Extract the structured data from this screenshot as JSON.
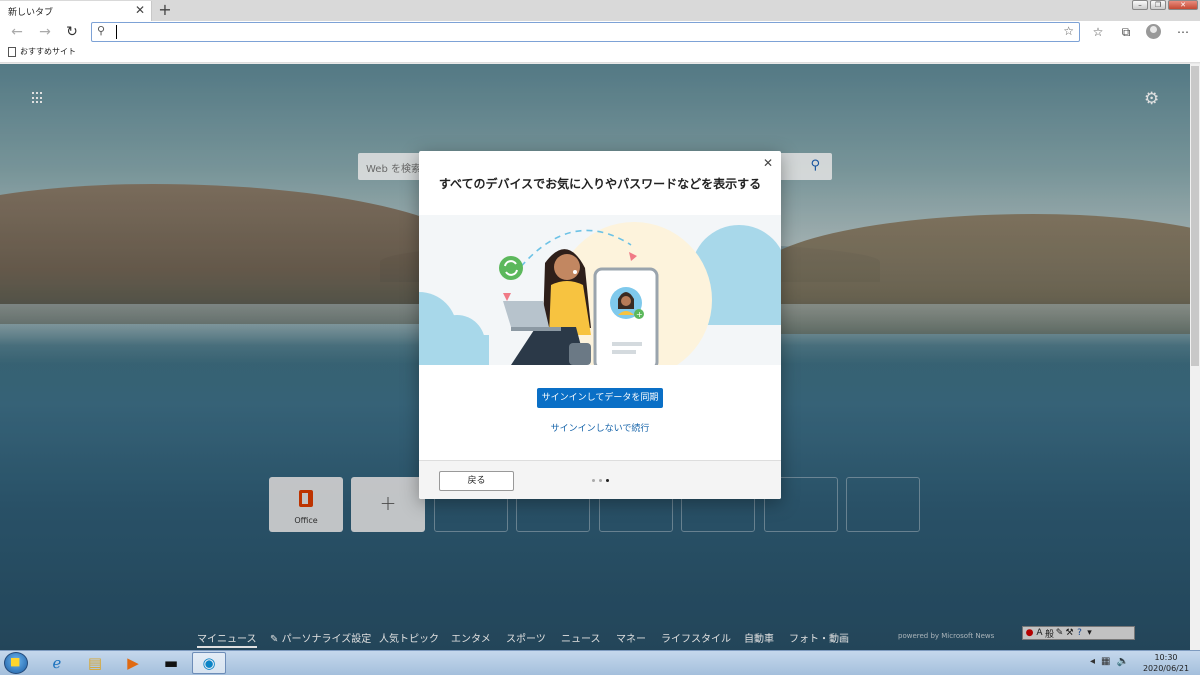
{
  "browser": {
    "tab_title": "新しいタブ",
    "tab_close": "✕",
    "new_tab": "+",
    "address_value": "",
    "bookmark_item": "おすすめサイト"
  },
  "page": {
    "search_placeholder": "Web を検索",
    "tiles": [
      {
        "label": "Office",
        "type": "office"
      },
      {
        "label": "+",
        "type": "add"
      }
    ],
    "news_nav": [
      {
        "label": "マイニュース",
        "active": true
      },
      {
        "label": "パーソナライズ設定",
        "active": false
      },
      {
        "label": "人気トピック",
        "active": false
      },
      {
        "label": "エンタメ",
        "active": false
      },
      {
        "label": "スポーツ",
        "active": false
      },
      {
        "label": "ニュース",
        "active": false
      },
      {
        "label": "マネー",
        "active": false
      },
      {
        "label": "ライフスタイル",
        "active": false
      },
      {
        "label": "自動車",
        "active": false
      },
      {
        "label": "フォト・動画",
        "active": false
      }
    ],
    "powered_by": "powered by Microsoft News",
    "ime": {
      "mode": "般",
      "label": "A"
    }
  },
  "dialog": {
    "title": "すべてのデバイスでお気に入りやパスワードなどを表示する",
    "primary_button": "サインインしてデータを同期",
    "secondary_link": "サインインしないで続行",
    "back_button": "戻る",
    "step_current": 3,
    "step_total": 3
  },
  "taskbar": {
    "time": "10:30",
    "date": "2020/06/21"
  },
  "colors": {
    "accent": "#0a6fc6",
    "link": "#1261a8",
    "office": "#d83b01"
  }
}
